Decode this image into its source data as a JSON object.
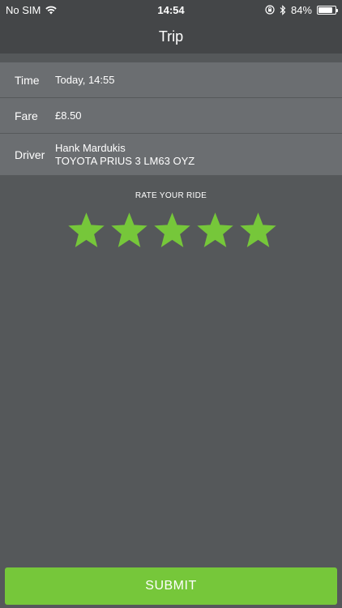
{
  "status_bar": {
    "carrier": "No SIM",
    "time": "14:54",
    "battery_text": "84%",
    "battery_level": 0.84,
    "icons": [
      "wifi-icon",
      "orientation-lock-icon",
      "bluetooth-icon",
      "battery-icon"
    ]
  },
  "nav": {
    "title": "Trip"
  },
  "trip": {
    "time_label": "Time",
    "time_value": "Today, 14:55",
    "fare_label": "Fare",
    "fare_value": "£8.50",
    "driver_label": "Driver",
    "driver_name": "Hank Mardukis",
    "driver_vehicle": "TOYOTA PRIUS 3 LM63 OYZ"
  },
  "rating": {
    "title": "RATE YOUR RIDE",
    "max_stars": 5,
    "filled_stars": 5,
    "star_color": "#76c73a"
  },
  "submit": {
    "label": "SUBMIT",
    "color": "#76c73a"
  },
  "colors": {
    "background": "#55585a",
    "header": "#444648",
    "row": "#6b6e71"
  }
}
